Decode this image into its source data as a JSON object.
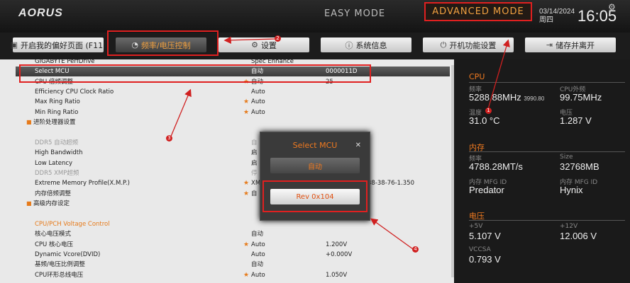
{
  "header": {
    "logo": "AORUS",
    "easy_mode": "EASY MODE",
    "advanced_mode": "ADVANCED MODE",
    "date": "03/14/2024",
    "weekday": "周四",
    "time": "16:05"
  },
  "tabs": [
    {
      "label": "开启我的偏好页面 (F11)",
      "icon": "bookmark-icon"
    },
    {
      "label": "频率/电压控制",
      "icon": "speedometer-icon"
    },
    {
      "label": "设置",
      "icon": "gear-icon"
    },
    {
      "label": "系统信息",
      "icon": "info-icon"
    },
    {
      "label": "开机功能设置",
      "icon": "power-icon"
    },
    {
      "label": "储存并离开",
      "icon": "exit-icon"
    }
  ],
  "settings": {
    "r0": {
      "label": "GIGABYTE PerfDrive",
      "value": "Spec Enhance"
    },
    "r1": {
      "label": "Select MCU",
      "value": "自动",
      "value2": "0000011D"
    },
    "r2": {
      "label": "CPU 倍频调整",
      "value": "自动",
      "value2": "25"
    },
    "r3": {
      "label": "Efficiency CPU Clock Ratio",
      "value": "Auto"
    },
    "r4": {
      "label": "Max Ring Ratio",
      "value": "Auto"
    },
    "r5": {
      "label": "Min Ring Ratio",
      "value": "Auto"
    },
    "r6": {
      "label": "进阶处理器设置"
    },
    "r7": {
      "label": "DDR5 自动超频",
      "value": "自"
    },
    "r8": {
      "label": "High Bandwidth",
      "value": "启"
    },
    "r9": {
      "label": "Low Latency",
      "value": "启"
    },
    "r10": {
      "label": "DDR5 XMP超频",
      "value": "停"
    },
    "r11": {
      "label": "Extreme Memory Profile(X.M.P.)",
      "value": "XM",
      "value2": "38-38-76-1.350"
    },
    "r12": {
      "label": "内存倍频调整",
      "value": "自"
    },
    "r13": {
      "label": "高级内存设定"
    },
    "r14": {
      "label": "CPU/PCH Voltage Control"
    },
    "r15": {
      "label": "核心电压模式",
      "value": "自动"
    },
    "r16": {
      "label": "CPU 核心电压",
      "value": "Auto",
      "value2": "1.200V"
    },
    "r17": {
      "label": "Dynamic Vcore(DVID)",
      "value": "Auto",
      "value2": "+0.000V"
    },
    "r18": {
      "label": "基频/电压比例调整",
      "value": "自动"
    },
    "r19": {
      "label": "CPU环形总线电压",
      "value": "Auto",
      "value2": "1.050V"
    }
  },
  "sidebar": {
    "cpu": {
      "title": "CPU",
      "freq_label": "频率",
      "freq_value": "5288.88MHz",
      "freq_sub": "3990.80",
      "ext_label": "CPU外频",
      "ext_value": "99.75MHz",
      "temp_label": "温度",
      "temp_value": "31.0 °C",
      "volt_label": "电压",
      "volt_value": "1.287 V"
    },
    "memory": {
      "title": "内存",
      "freq_label": "频率",
      "freq_value": "4788.28MT/s",
      "size_label": "Size",
      "size_value": "32768MB",
      "mfg_label": "内存 MFG ID",
      "mfg_value": "Predator",
      "mfg2_label": "内存 MFG ID",
      "mfg2_value": "Hynix"
    },
    "voltage": {
      "title": "电压",
      "p5_label": "+5V",
      "p5_value": "5.107 V",
      "p12_label": "+12V",
      "p12_value": "12.006 V",
      "vccsa_label": "VCCSA",
      "vccsa_value": "0.793 V"
    }
  },
  "popup": {
    "title": "Select MCU",
    "option_auto": "自动",
    "option_rev": "Rev 0x104"
  },
  "annotations": [
    "1",
    "2",
    "3",
    "4"
  ],
  "colors": {
    "accent": "#f07a20",
    "highlight": "#e02020"
  }
}
